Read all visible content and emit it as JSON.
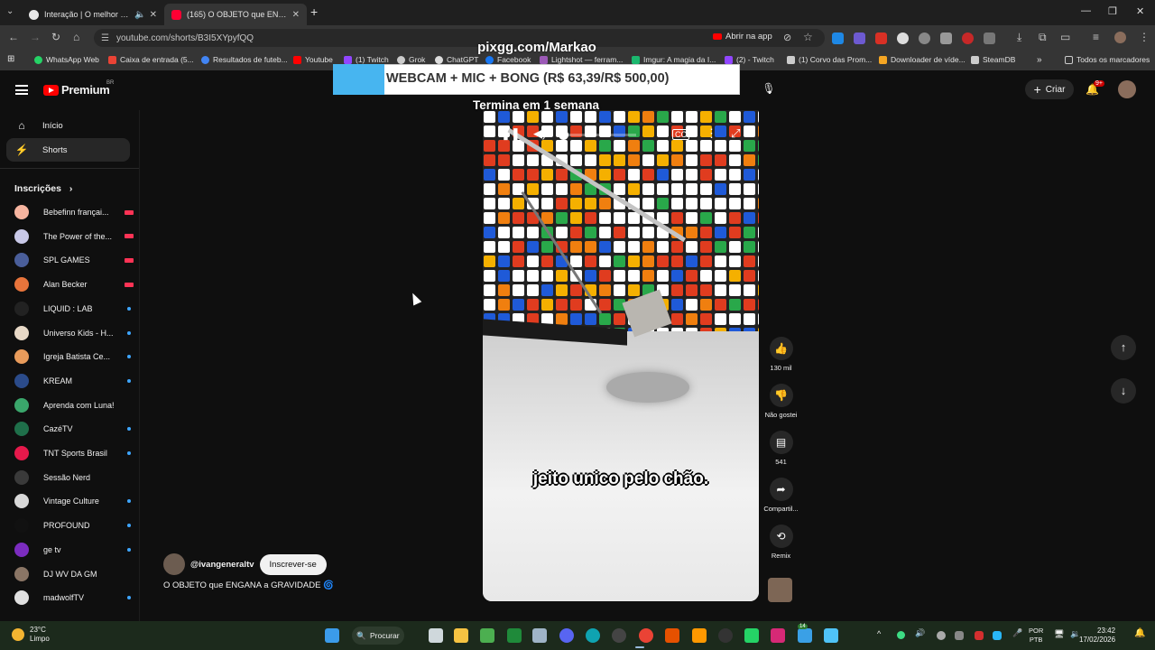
{
  "browser": {
    "tabs": [
      {
        "title": "Interação | O melhor softw",
        "icon_color": "#e8e8e8"
      },
      {
        "title": "(165) O OBJETO que ENGANA a",
        "icon_color": "#ff0033"
      }
    ],
    "url": "youtube.com/shorts/B3I5XYpyfQQ",
    "open_app_label": "Abrir na app",
    "bookmarks": [
      {
        "label": "WhatsApp Web",
        "color": "#25d366"
      },
      {
        "label": "Caixa de entrada (5...",
        "color": "#ea4335"
      },
      {
        "label": "Resultados de futeb...",
        "color": "#4285f4"
      },
      {
        "label": "Youtube",
        "color": "#ff0000"
      },
      {
        "label": "(1) Twitch",
        "color": "#9146ff"
      },
      {
        "label": "Grok",
        "color": "#cccccc"
      },
      {
        "label": "ChatGPT",
        "color": "#dddddd"
      },
      {
        "label": "Facebook",
        "color": "#1877f2"
      },
      {
        "label": "Lightshot — ferram...",
        "color": "#9b59b6"
      },
      {
        "label": "Imgur: A magia da I...",
        "color": "#1bb76e"
      },
      {
        "label": "(2) - Twitch",
        "color": "#9146ff"
      },
      {
        "label": "(1) Corvo das Prom...",
        "color": "#cccccc"
      },
      {
        "label": "Downloader de víde...",
        "color": "#f5a623"
      },
      {
        "label": "SteamDB",
        "color": "#cccccc"
      }
    ],
    "bookmarks_all": "Todos os marcadores",
    "bookmarks_more": "»"
  },
  "youtube": {
    "logo_text": "Premium",
    "logo_region": "BR",
    "create_label": "Criar",
    "notif_count": "9+",
    "nav": [
      {
        "label": "Início",
        "icon": "⌂"
      },
      {
        "label": "Shorts",
        "icon": "⚡"
      }
    ],
    "subs_header": "Inscrições",
    "subs_chevron": "›",
    "subscriptions": [
      {
        "name": "Bebefinn françai...",
        "status": "live",
        "color": "#f7b5a0"
      },
      {
        "name": "The Power of the...",
        "status": "live",
        "color": "#c9c9e8"
      },
      {
        "name": "SPL GAMES",
        "status": "live",
        "color": "#4a5e9a"
      },
      {
        "name": "Alan Becker",
        "status": "live",
        "color": "#e8743b"
      },
      {
        "name": "LIQUID : LAB",
        "status": "new",
        "color": "#222222"
      },
      {
        "name": "Universo Kids - H...",
        "status": "new",
        "color": "#e8d9c7"
      },
      {
        "name": "Igreja Batista Ce...",
        "status": "new",
        "color": "#e89b5b"
      },
      {
        "name": "KREAM",
        "status": "new",
        "color": "#2b4b8a"
      },
      {
        "name": "Aprenda com Luna!",
        "status": "",
        "color": "#3aa66b"
      },
      {
        "name": "CazéTV",
        "status": "new",
        "color": "#1f6f4a"
      },
      {
        "name": "TNT Sports Brasil",
        "status": "new",
        "color": "#e6194b"
      },
      {
        "name": "Sessão Nerd",
        "status": "",
        "color": "#3a3a3a"
      },
      {
        "name": "Vintage Culture",
        "status": "new",
        "color": "#d8d8d8"
      },
      {
        "name": "PROFOUND",
        "status": "new",
        "color": "#111111"
      },
      {
        "name": "ge tv",
        "status": "new",
        "color": "#7b2cbf"
      },
      {
        "name": "DJ WV DA GM",
        "status": "",
        "color": "#8a7565"
      },
      {
        "name": "madwolfTV",
        "status": "new",
        "color": "#e0e0e0"
      }
    ]
  },
  "short": {
    "caption": "jeito unico pelo chão.",
    "channel": "@ivangeneraltv",
    "subscribe_label": "Inscrever-se",
    "title": "O OBJETO que ENGANA a GRAVIDADE 🌀",
    "likes": "130 mil",
    "dislike_label": "Não gostei",
    "comments": "541",
    "share_label": "Compartil...",
    "remix_label": "Remix",
    "progress": 0.0
  },
  "overlay": {
    "top_text": "pixgg.com/Markao",
    "goal_text": "WEBCAM + MIC + BONG (R$ 63,39/R$ 500,00)",
    "goal_progress": 0.1268,
    "ends_text": "Termina em 1 semana"
  },
  "taskbar": {
    "temp": "23°C",
    "weather": "Limpo",
    "search_label": "Procurar",
    "lang1": "POR",
    "lang2": "PTB",
    "time": "23:42",
    "date": "17/02/2026",
    "badge": "14"
  }
}
